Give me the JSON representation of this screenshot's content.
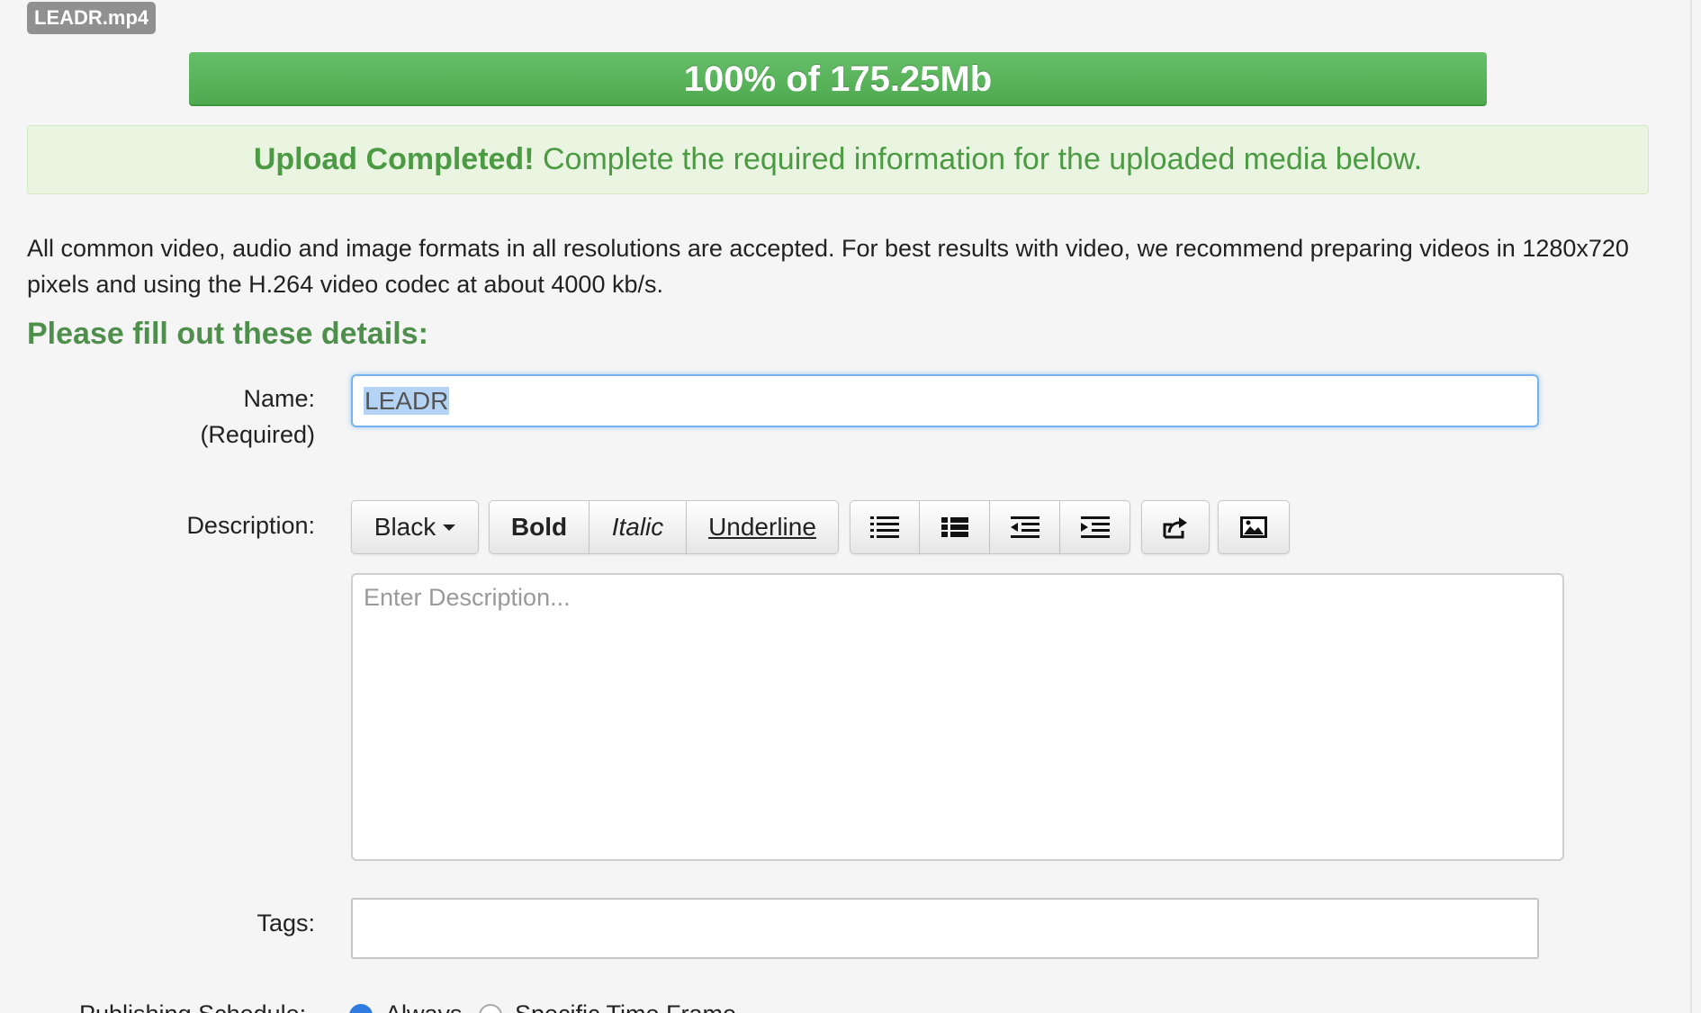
{
  "file": {
    "name": "LEADR.mp4"
  },
  "upload": {
    "progress_label": "100% of 175.25Mb",
    "percent": 100,
    "alert_strong": "Upload Completed!",
    "alert_text": " Complete the required information for the uploaded media below.",
    "accent_color": "#5cb85c"
  },
  "info_text": "All common video, audio and image formats in all resolutions are accepted. For best results with video, we recommend preparing videos in 1280x720 pixels and using the H.264 video codec at about 4000 kb/s.",
  "form": {
    "title": "Please fill out these details:",
    "name_label": "Name:",
    "name_required": "(Required)",
    "name_value": "LEADR",
    "description_label": "Description:",
    "description_placeholder": "Enter Description...",
    "tags_label": "Tags:",
    "publishing_label": "Publishing Schedule:",
    "publishing_options": [
      "Always",
      "Specific Time Frame"
    ]
  },
  "toolbar": {
    "color": "Black",
    "bold": "Bold",
    "italic": "Italic",
    "underline": "Underline",
    "icons": [
      "unordered-list-icon",
      "ordered-list-icon",
      "outdent-icon",
      "indent-icon",
      "share-icon",
      "image-icon"
    ]
  }
}
